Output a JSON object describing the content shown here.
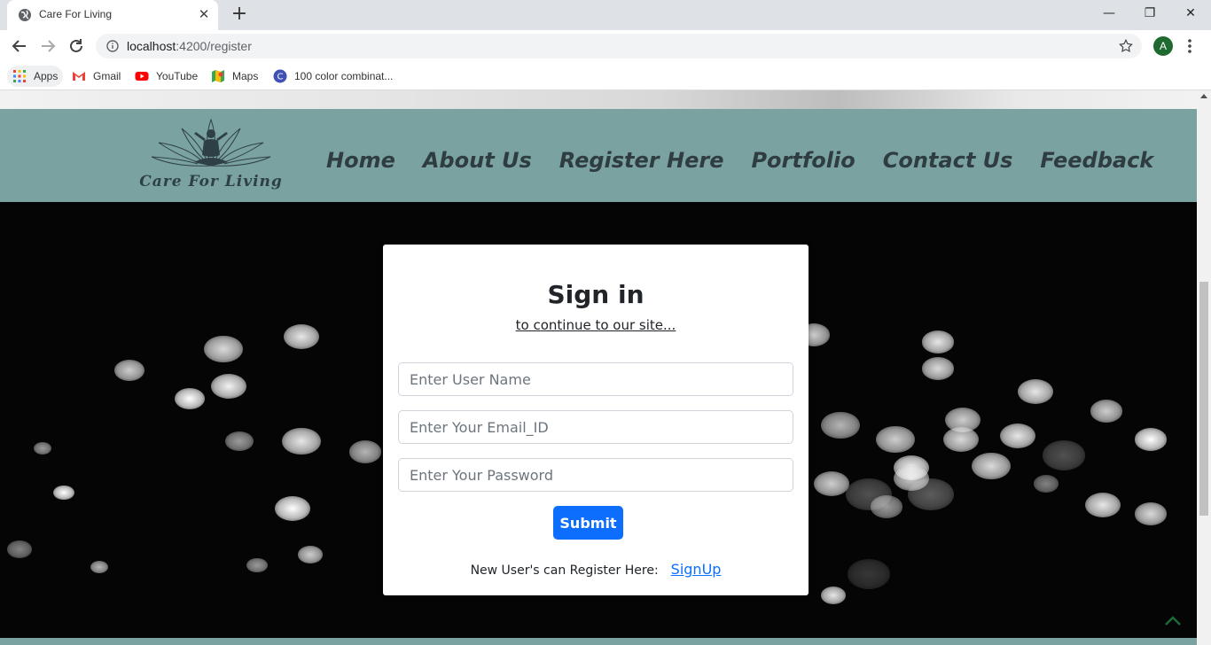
{
  "browser": {
    "tab_title": "Care For Living",
    "tab_close": "✕",
    "new_tab": "+",
    "window_controls": {
      "minimize": "—",
      "restore": "❐",
      "close": "✕"
    },
    "url_host": "localhost",
    "url_port_path": ":4200/register",
    "profile_initial": "A",
    "bookmarks": [
      {
        "label": "Apps",
        "icon": "apps-grid-icon"
      },
      {
        "label": "Gmail",
        "icon": "gmail-icon"
      },
      {
        "label": "YouTube",
        "icon": "youtube-icon"
      },
      {
        "label": "Maps",
        "icon": "maps-icon"
      },
      {
        "label": "100 color combinat...",
        "icon": "c-favicon-icon"
      }
    ]
  },
  "site": {
    "logo_text": "Care For Living",
    "nav": [
      "Home",
      "About Us",
      "Register Here",
      "Portfolio",
      "Contact Us",
      "Feedback"
    ],
    "colors": {
      "nav_bg": "#7aa2a0",
      "nav_text": "#2f3d40",
      "primary": "#0d6efd"
    }
  },
  "form": {
    "title": "Sign in",
    "subtitle": "to continue to our site...",
    "username_placeholder": "Enter User Name",
    "email_placeholder": "Enter Your Email_ID",
    "password_placeholder": "Enter Your Password",
    "submit_label": "Submit",
    "register_prompt": "New User's can Register Here:",
    "signup_link": "SignUp"
  }
}
